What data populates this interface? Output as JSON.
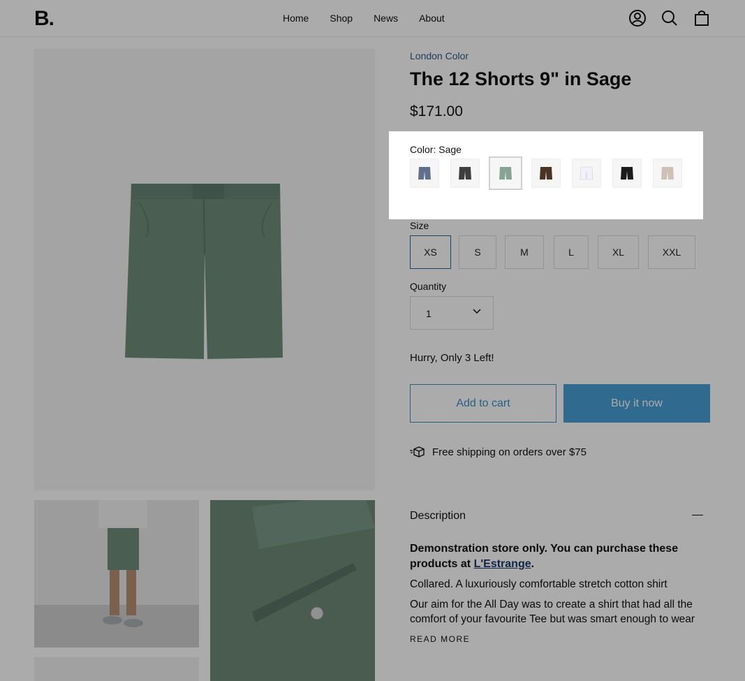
{
  "header": {
    "logo": "B.",
    "nav": [
      "Home",
      "Shop",
      "News",
      "About"
    ],
    "icons": [
      "account-icon",
      "search-icon",
      "cart-icon"
    ]
  },
  "product": {
    "vendor": "London Color",
    "title": "The 12 Shorts 9\" in Sage",
    "price": "$171.00",
    "color_label": "Color: Sage",
    "swatches": [
      {
        "name": "Slate Blue",
        "color": "#5f6f8c"
      },
      {
        "name": "Charcoal",
        "color": "#3d3f3e"
      },
      {
        "name": "Sage",
        "color": "#86a395",
        "selected": true
      },
      {
        "name": "Brown",
        "color": "#4a3424"
      },
      {
        "name": "White",
        "color": "#f1f1f7"
      },
      {
        "name": "Black",
        "color": "#1b1b1b"
      },
      {
        "name": "Stone",
        "color": "#cfc2b4"
      }
    ],
    "size_label": "Size",
    "sizes": [
      "XS",
      "S",
      "M",
      "L",
      "XL",
      "XXL"
    ],
    "selected_size": "XS",
    "quantity_label": "Quantity",
    "quantity": "1",
    "stock_text": "Hurry, Only 3 Left!",
    "add_to_cart": "Add to cart",
    "buy_now": "Buy it now",
    "shipping_text": "Free shipping on orders over $75",
    "description_title": "Description",
    "description_bold": "Demonstration store only. You can purchase these products at ",
    "description_link": "L'Estrange",
    "description_bold_end": ".",
    "description_p1": "Collared. A luxuriously comfortable stretch cotton shirt",
    "description_p2": "Our aim for the All Day was to create a shirt that had all the comfort of your favourite Tee but was smart enough to wear",
    "read_more": "READ MORE"
  },
  "colors": {
    "accent": "#4a9fd6",
    "link": "#2d5b86",
    "shorts": "#6f8c7b"
  }
}
